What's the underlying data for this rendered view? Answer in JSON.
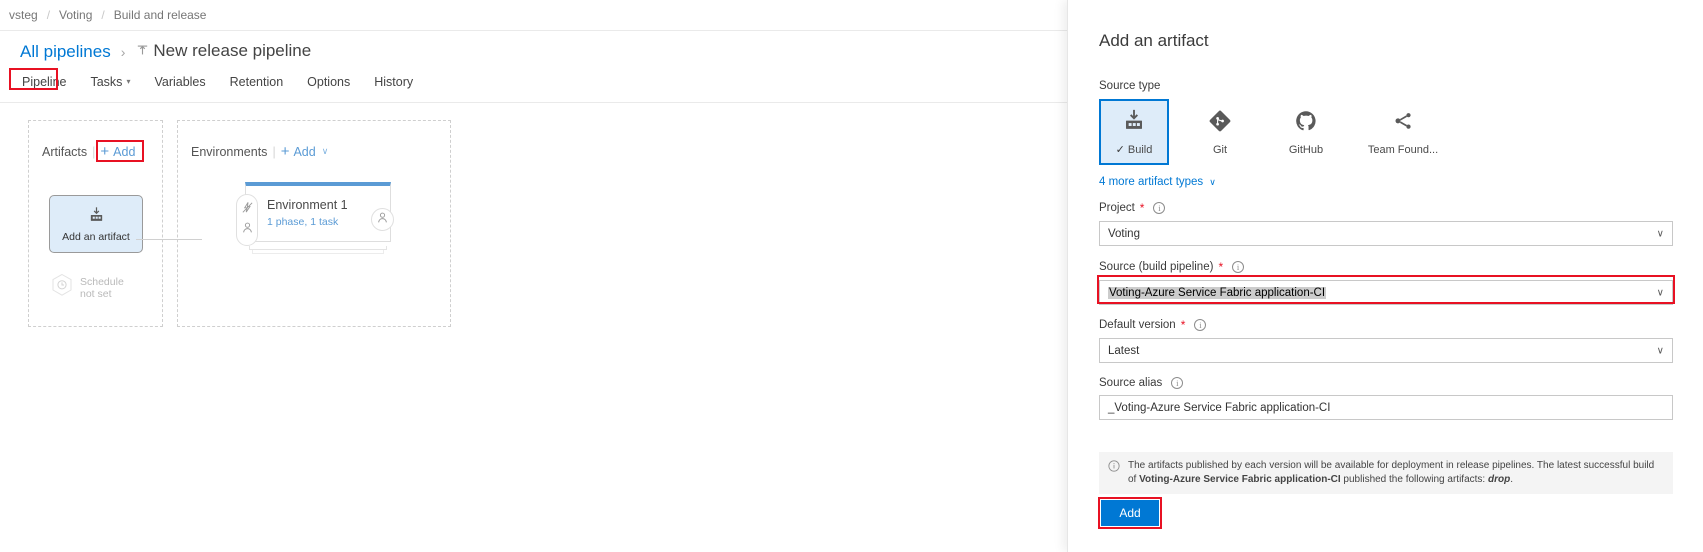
{
  "breadcrumb": {
    "items": [
      "vsteg",
      "Voting",
      "Build and release"
    ],
    "separator": "/"
  },
  "page_header": {
    "all_pipelines_link": "All pipelines",
    "chevron": "›",
    "title": "New release pipeline"
  },
  "tabs": [
    {
      "label": "Pipeline",
      "has_caret": false,
      "highlighted": true
    },
    {
      "label": "Tasks",
      "has_caret": true,
      "highlighted": false
    },
    {
      "label": "Variables",
      "has_caret": false,
      "highlighted": false
    },
    {
      "label": "Retention",
      "has_caret": false,
      "highlighted": false
    },
    {
      "label": "Options",
      "has_caret": false,
      "highlighted": false
    },
    {
      "label": "History",
      "has_caret": false,
      "highlighted": false
    }
  ],
  "artifacts_panel": {
    "title": "Artifacts",
    "divider": "|",
    "add_label": "Add",
    "add_plus": "+",
    "card_label": "Add an artifact",
    "card_icon": "build-artifact-icon",
    "schedule_icon": "clock-hexagon-icon",
    "schedule_line1": "Schedule",
    "schedule_line2": "not set"
  },
  "environments_panel": {
    "title": "Environments",
    "divider": "|",
    "add_label": "Add",
    "add_plus": "+",
    "add_caret": "∨",
    "environment": {
      "name": "Environment 1",
      "subtitle": "1 phase, 1 task",
      "pre_icons": [
        "lightning-approval-icon",
        "person-icon"
      ],
      "post_icon": "person-icon"
    }
  },
  "artifact_panel": {
    "title": "Add an artifact",
    "source_type": {
      "label": "Source type",
      "tiles": [
        {
          "label": "Build",
          "icon": "build-artifact-icon",
          "selected": true,
          "check": "✓"
        },
        {
          "label": "Git",
          "icon": "git-icon",
          "selected": false
        },
        {
          "label": "GitHub",
          "icon": "github-icon",
          "selected": false
        },
        {
          "label": "Team Found...",
          "icon": "tfvc-icon",
          "selected": false
        }
      ],
      "more_link": "4 more artifact types",
      "more_caret": "∨"
    },
    "fields": [
      {
        "label": "Project",
        "required": true,
        "info": true,
        "value": "Voting",
        "type": "select",
        "caret": "∨",
        "highlighted_red": false,
        "selected_text": false
      },
      {
        "label": "Source (build pipeline)",
        "required": true,
        "info": true,
        "value": "Voting-Azure Service Fabric application-CI",
        "type": "select",
        "caret": "∨",
        "highlighted_red": true,
        "selected_text": true
      },
      {
        "label": "Default version",
        "required": true,
        "info": true,
        "value": "Latest",
        "type": "select",
        "caret": "∨",
        "highlighted_red": false,
        "selected_text": false
      },
      {
        "label": "Source alias",
        "required": false,
        "info": true,
        "value": "_Voting-Azure Service Fabric application-CI",
        "type": "text",
        "caret": "",
        "highlighted_red": false,
        "selected_text": false
      }
    ],
    "info_box": {
      "icon": "info-circle-icon",
      "text_part1": "The artifacts published by each version will be available for deployment in release pipelines. The latest successful build of ",
      "text_bold": "Voting-Azure Service Fabric application-CI",
      "text_part2": "  published the following artifacts: ",
      "text_italic": "drop",
      "text_end": "."
    },
    "add_button": "Add"
  },
  "colors": {
    "accent": "#0078d4",
    "link": "#0078d4",
    "highlight_red": "#e81123",
    "selected_tile_bg": "#deecf9",
    "env_top_bar": "#5b9bd5"
  }
}
